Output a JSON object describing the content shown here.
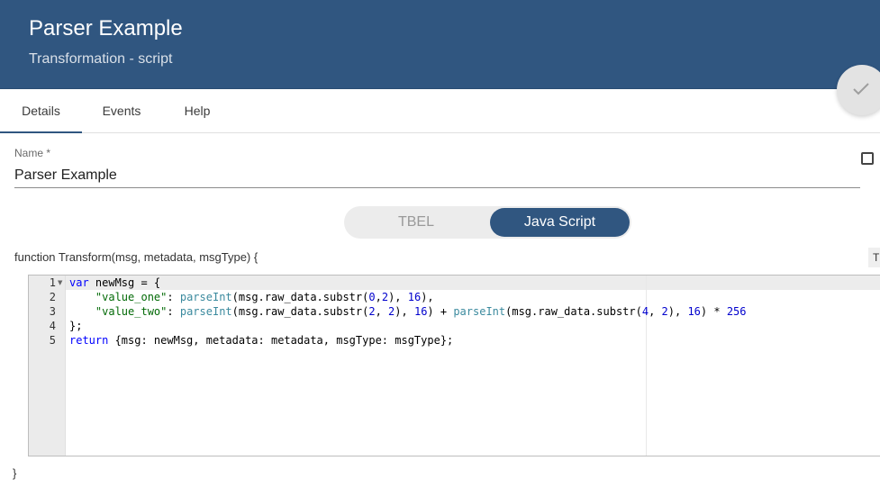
{
  "header": {
    "title": "Parser Example",
    "subtitle": "Transformation - script",
    "background": "#305680"
  },
  "tabs": [
    {
      "label": "Details",
      "active": true
    },
    {
      "label": "Events",
      "active": false
    },
    {
      "label": "Help",
      "active": false
    }
  ],
  "form": {
    "name_label": "Name *",
    "name_value": "Parser Example"
  },
  "language_toggle": {
    "options": [
      "TBEL",
      "Java Script"
    ],
    "selected": "Java Script"
  },
  "editor": {
    "function_signature": "function Transform(msg, metadata, msgType) {",
    "side_button_label": "T",
    "line_numbers": [
      "1",
      "2",
      "3",
      "4",
      "5"
    ],
    "closing_brace": "}",
    "code_lines": [
      "var newMsg = {",
      "    \"value_one\": parseInt(msg.raw_data.substr(0,2), 16),",
      "    \"value_two\": parseInt(msg.raw_data.substr(2, 2), 16) + parseInt(msg.raw_data.substr(4, 2), 16) * 256",
      "};",
      "return {msg: newMsg, metadata: metadata, msgType: msgType};"
    ]
  },
  "icons": {
    "fab": "check-icon",
    "fold": "fold-arrow-icon"
  }
}
